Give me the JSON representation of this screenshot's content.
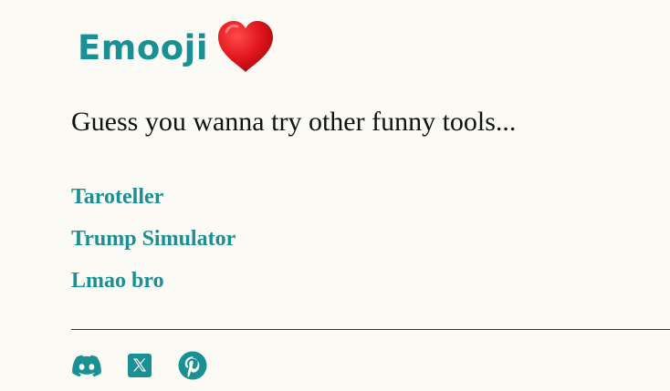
{
  "brand": {
    "name": "Emooji",
    "color": "#1a8f94",
    "heart_icon": "red-heart-icon"
  },
  "headline": "Guess you wanna try other funny tools...",
  "tools": [
    {
      "label": "Taroteller"
    },
    {
      "label": "Trump Simulator"
    },
    {
      "label": "Lmao bro"
    }
  ],
  "social": [
    {
      "icon": "discord-icon"
    },
    {
      "icon": "x-icon"
    },
    {
      "icon": "pinterest-icon"
    }
  ]
}
